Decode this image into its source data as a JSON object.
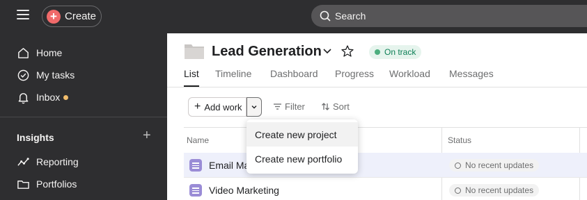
{
  "topbar": {
    "create_label": "Create",
    "search_label": "Search"
  },
  "sidebar": {
    "nav": [
      {
        "label": "Home",
        "icon": "home-icon"
      },
      {
        "label": "My tasks",
        "icon": "check-circle-icon"
      },
      {
        "label": "Inbox",
        "icon": "bell-icon",
        "unread": true
      }
    ],
    "insights_label": "Insights",
    "insights_add": "+",
    "insights_items": [
      {
        "label": "Reporting",
        "icon": "line-chart-icon"
      },
      {
        "label": "Portfolios",
        "icon": "folder-icon"
      }
    ]
  },
  "project": {
    "title": "Lead Generation",
    "status": "On track",
    "status_color": "#4cae7e",
    "tabs": [
      "List",
      "Timeline",
      "Dashboard",
      "Progress",
      "Workload",
      "Messages"
    ],
    "active_tab": "List"
  },
  "toolbar": {
    "add_work": "Add work",
    "filter": "Filter",
    "sort": "Sort"
  },
  "table": {
    "columns": [
      "Name",
      "Status"
    ],
    "rows": [
      {
        "name": "Email Ma",
        "status": "No recent updates"
      },
      {
        "name": "Video Marketing",
        "status": "No recent updates"
      }
    ]
  },
  "menu": {
    "items": [
      "Create new project",
      "Create new portfolio"
    ]
  }
}
